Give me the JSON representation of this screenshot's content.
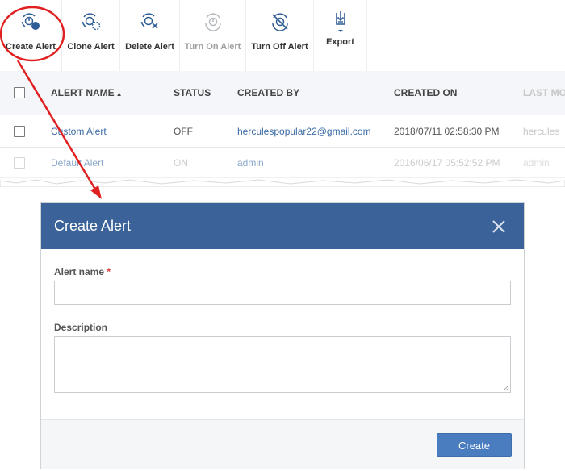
{
  "toolbar": {
    "items": [
      {
        "label": "Create Alert",
        "icon": "create-alert-icon",
        "enabled": true
      },
      {
        "label": "Clone Alert",
        "icon": "clone-alert-icon",
        "enabled": true
      },
      {
        "label": "Delete Alert",
        "icon": "delete-alert-icon",
        "enabled": true
      },
      {
        "label": "Turn On Alert",
        "icon": "turn-on-alert-icon",
        "enabled": false
      },
      {
        "label": "Turn Off Alert",
        "icon": "turn-off-alert-icon",
        "enabled": true
      },
      {
        "label": "Export",
        "icon": "export-icon",
        "enabled": true
      }
    ]
  },
  "table": {
    "columns": [
      "ALERT NAME",
      "STATUS",
      "CREATED BY",
      "CREATED ON",
      "LAST MO"
    ],
    "sort_indicator": "▲",
    "rows": [
      {
        "name": "Custom Alert",
        "status": "OFF",
        "created_by": "herculespopular22@gmail.com",
        "created_on": "2018/07/11 02:58:30 PM",
        "last_modified": "hercules"
      },
      {
        "name": "Default Alert",
        "status": "ON",
        "created_by": "admin",
        "created_on": "2016/06/17 05:52:52 PM",
        "last_modified": "admin"
      }
    ]
  },
  "dialog": {
    "title": "Create Alert",
    "alert_name_label": "Alert name",
    "required_mark": "*",
    "alert_name_value": "",
    "description_label": "Description",
    "description_value": "",
    "create_button": "Create"
  },
  "colors": {
    "header_blue": "#3b6399",
    "button_blue": "#4a7dc0",
    "link_blue": "#3a6aa5",
    "annotation_red": "#e02020",
    "icon_blue": "#2f5d95"
  }
}
